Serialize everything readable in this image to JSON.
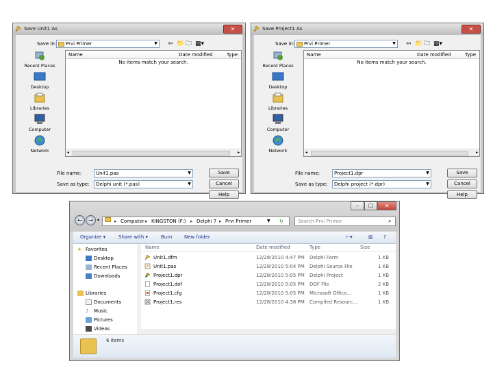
{
  "dialog1": {
    "title": "Save Unit1 As",
    "save_in_label": "Save in:",
    "save_in_value": "Prvi Primer",
    "columns": [
      "Name",
      "Date modified",
      "Type"
    ],
    "empty_message": "No items match your search.",
    "places": [
      "Recent Places",
      "Desktop",
      "Libraries",
      "Computer",
      "Network"
    ],
    "file_name_label": "File name:",
    "file_name_value": "Unit1.pas",
    "save_as_type_label": "Save as type:",
    "save_as_type_value": "Delphi unit (*.pas)",
    "buttons": {
      "save": "Save",
      "cancel": "Cancel",
      "help": "Help"
    }
  },
  "dialog2": {
    "title": "Save Project1 As",
    "save_in_label": "Save in:",
    "save_in_value": "Prvi Primer",
    "columns": [
      "Name",
      "Date modified",
      "Type"
    ],
    "empty_message": "No items match your search.",
    "places": [
      "Recent Places",
      "Desktop",
      "Libraries",
      "Computer",
      "Network"
    ],
    "file_name_label": "File name:",
    "file_name_value": "Project1.dpr",
    "save_as_type_label": "Save as type:",
    "save_as_type_value": "Delphi project (*.dpr)",
    "buttons": {
      "save": "Save",
      "cancel": "Cancel",
      "help": "Help"
    }
  },
  "explorer": {
    "breadcrumb": [
      "Computer",
      "KINGSTON (F:)",
      "Delphi 7",
      "Prvi Primer"
    ],
    "search_placeholder": "Search Prvi Primer",
    "commands": [
      "Organize ▾",
      "Share with ▾",
      "Burn",
      "New folder"
    ],
    "favorites_label": "Favorites",
    "favorites": [
      "Desktop",
      "Recent Places",
      "Downloads"
    ],
    "libraries_label": "Libraries",
    "libraries": [
      "Documents",
      "Music",
      "Pictures",
      "Videos"
    ],
    "columns": {
      "name": "Name",
      "date": "Date modified",
      "type": "Type",
      "size": "Size"
    },
    "files": [
      {
        "name": "Unit1.dfm",
        "date": "12/28/2010 4:47 PM",
        "type": "Delphi Form",
        "size": "1 KB"
      },
      {
        "name": "Unit1.pas",
        "date": "12/28/2010 5:04 PM",
        "type": "Delphi Source File",
        "size": "1 KB"
      },
      {
        "name": "Project1.dpr",
        "date": "12/28/2010 5:05 PM",
        "type": "Delphi Project",
        "size": "1 KB"
      },
      {
        "name": "Project1.dof",
        "date": "12/28/2010 5:05 PM",
        "type": "DOF File",
        "size": "2 KB"
      },
      {
        "name": "Project1.cfg",
        "date": "12/28/2010 5:05 PM",
        "type": "Microsoft Office...",
        "size": "1 KB"
      },
      {
        "name": "Project1.res",
        "date": "12/28/2010 4:38 PM",
        "type": "Compiled Resourc...",
        "size": "1 KB"
      }
    ],
    "item_count": "6 items"
  }
}
